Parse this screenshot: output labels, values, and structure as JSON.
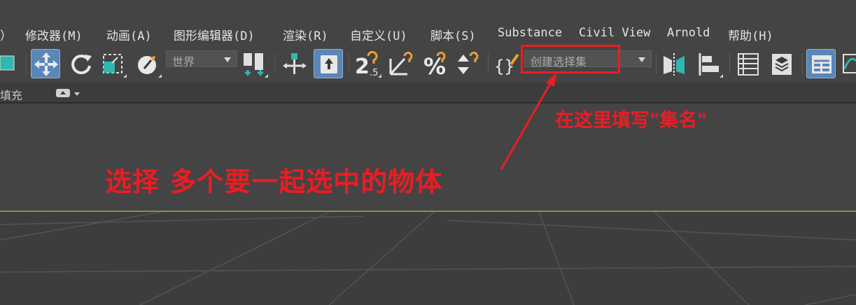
{
  "menubar": {
    "items": [
      "）",
      "修改器(M)",
      "动画(A)",
      "图形编辑器(D)",
      "渲染(R)",
      "自定义(U)",
      "脚本(S)",
      "Substance",
      "Civil View",
      "Arnold",
      "帮助(H)"
    ]
  },
  "toolbar": {
    "coord_dropdown": {
      "value": "世界"
    },
    "selection_set_dropdown": {
      "placeholder": "创建选择集"
    },
    "icons": [
      "object-color-swatch-icon",
      "move-icon",
      "rotate-icon",
      "scale-icon",
      "place-icon",
      "coordinate-system-dropdown",
      "pivot-center-icon",
      "select-manipulate-icon",
      "keyboard-shortcut-override-icon",
      "snap-2.5d-icon",
      "angle-snap-icon",
      "percent-snap-icon",
      "spinner-snap-icon",
      "edit-named-selection-sets-icon",
      "mirror-icon",
      "align-icon",
      "scene-explorer-icon",
      "layer-explorer-icon",
      "toggle-ribbon-icon",
      "curve-editor-icon"
    ]
  },
  "ribbon": {
    "label": "填充"
  },
  "annotations": {
    "main_instruction": "选择 多个要一起选中的物体",
    "name_instruction": "在这里填写\"集名\""
  },
  "colors": {
    "background": "#444444",
    "accent_active": "#5a86b8",
    "annotation_red": "#ec1c24",
    "viewport_border": "#9a8a3a"
  }
}
